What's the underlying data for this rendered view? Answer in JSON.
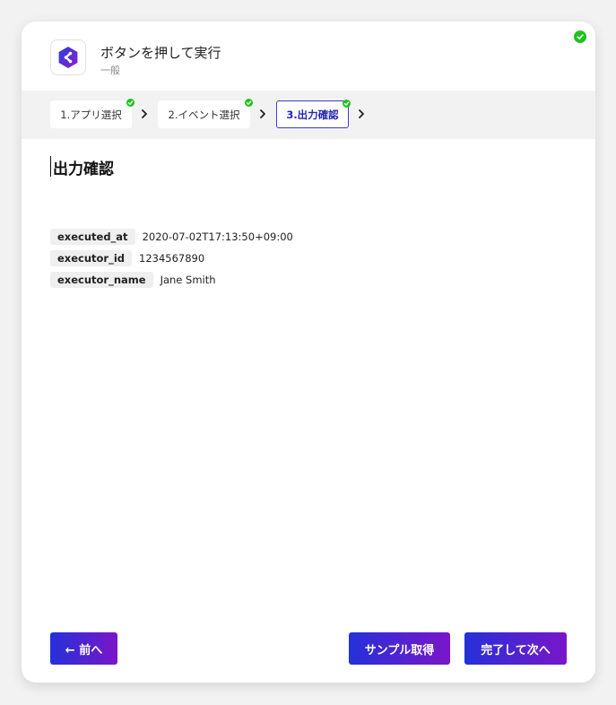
{
  "header": {
    "title": "ボタンを押して実行",
    "subtitle": "一般",
    "app_icon": "app-logo-icon",
    "status": "complete",
    "status_icon": "check-circle-icon",
    "status_color": "#1ec31e"
  },
  "steps": [
    {
      "label": "1.アプリ選択",
      "completed": true
    },
    {
      "label": "2.イベント選択",
      "completed": true
    },
    {
      "label": "3.出力確認",
      "completed": true,
      "active": true
    }
  ],
  "section_title": "出力確認",
  "outputs": [
    {
      "key": "executed_at",
      "value": "2020-07-02T17:13:50+09:00"
    },
    {
      "key": "executor_id",
      "value": "1234567890"
    },
    {
      "key": "executor_name",
      "value": "Jane Smith"
    }
  ],
  "footer": {
    "prev_label": "← 前へ",
    "sample_label": "サンプル取得",
    "next_label": "完了して次へ"
  },
  "colors": {
    "accent_start": "#2431d8",
    "accent_end": "#7a16c9",
    "active_step_border": "#3a3ad0"
  }
}
